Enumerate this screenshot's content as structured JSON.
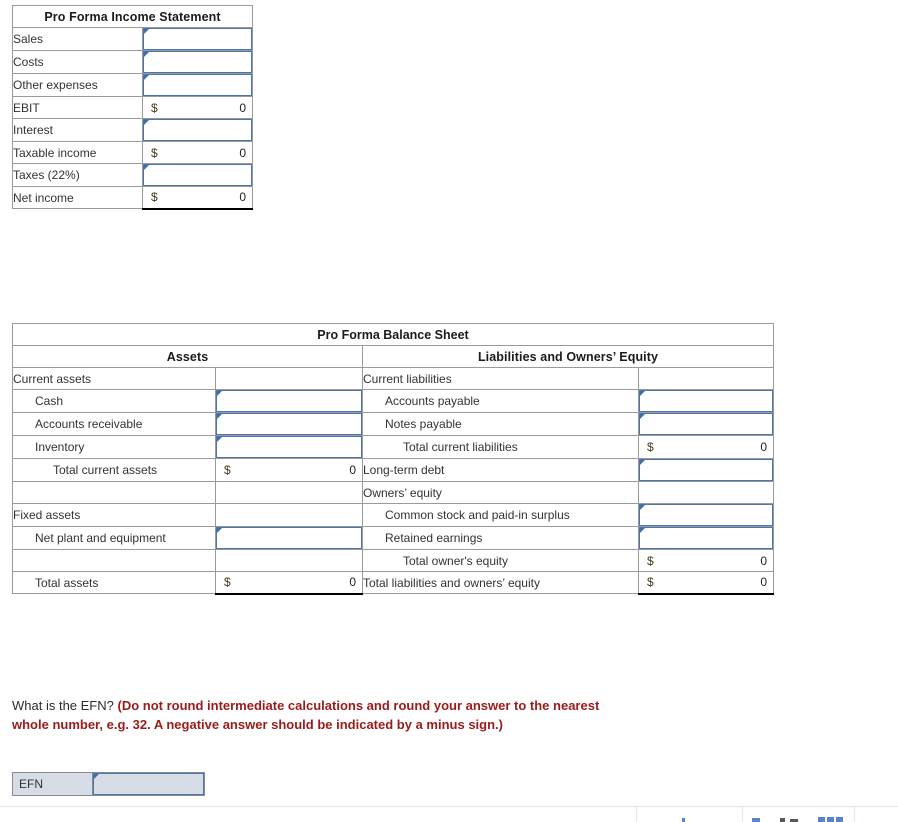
{
  "income_statement": {
    "title": "Pro Forma Income Statement",
    "currency_symbol": "$",
    "rows": [
      {
        "label": "Sales",
        "type": "input",
        "value": ""
      },
      {
        "label": "Costs",
        "type": "input",
        "value": ""
      },
      {
        "label": "Other expenses",
        "type": "input",
        "value": ""
      },
      {
        "label": "EBIT",
        "type": "calc",
        "symbol": "$",
        "value": "0"
      },
      {
        "label": "Interest",
        "type": "input",
        "value": ""
      },
      {
        "label": "Taxable income",
        "type": "calc",
        "symbol": "$",
        "value": "0"
      },
      {
        "label": "Taxes (22%)",
        "type": "input",
        "value": ""
      },
      {
        "label": "Net income",
        "type": "calc",
        "symbol": "$",
        "value": "0"
      }
    ]
  },
  "balance_sheet": {
    "title": "Pro Forma Balance Sheet",
    "assets_header": "Assets",
    "liabilities_header": "Liabilities and Owners’ Equity",
    "rows": [
      {
        "left": {
          "label": "Current assets",
          "indent": 0,
          "type": "none"
        },
        "right": {
          "label": "Current liabilities",
          "indent": 0,
          "type": "none"
        }
      },
      {
        "left": {
          "label": "Cash",
          "indent": 1,
          "type": "input",
          "value": ""
        },
        "right": {
          "label": "Accounts payable",
          "indent": 1,
          "type": "input",
          "value": ""
        }
      },
      {
        "left": {
          "label": "Accounts receivable",
          "indent": 1,
          "type": "input",
          "value": ""
        },
        "right": {
          "label": "Notes payable",
          "indent": 1,
          "type": "input",
          "value": ""
        }
      },
      {
        "left": {
          "label": "Inventory",
          "indent": 1,
          "type": "input",
          "value": ""
        },
        "right": {
          "label": "Total current liabilities",
          "indent": 2,
          "type": "calc",
          "symbol": "$",
          "value": "0"
        }
      },
      {
        "left": {
          "label": "Total current assets",
          "indent": 2,
          "type": "calc",
          "symbol": "$",
          "value": "0"
        },
        "right": {
          "label": "Long-term debt",
          "indent": 0,
          "type": "input",
          "value": ""
        }
      },
      {
        "left": {
          "label": "",
          "indent": 0,
          "type": "blank"
        },
        "right": {
          "label": "Owners’ equity",
          "indent": 0,
          "type": "none"
        }
      },
      {
        "left": {
          "label": "Fixed assets",
          "indent": 0,
          "type": "none"
        },
        "right": {
          "label": "Common stock and paid-in surplus",
          "indent": 1,
          "type": "input",
          "value": ""
        }
      },
      {
        "left": {
          "label": "Net plant and equipment",
          "indent": 1,
          "type": "input",
          "value": ""
        },
        "right": {
          "label": "Retained earnings",
          "indent": 1,
          "type": "input",
          "value": ""
        }
      },
      {
        "left": {
          "label": "",
          "indent": 0,
          "type": "blank"
        },
        "right": {
          "label": "Total owner's equity",
          "indent": 2,
          "type": "calc",
          "symbol": "$",
          "value": "0"
        }
      },
      {
        "left": {
          "label": "Total assets",
          "indent": 1,
          "type": "calc",
          "symbol": "$",
          "value": "0",
          "rule": true
        },
        "right": {
          "label": "Total liabilities and owners’ equity",
          "indent": 0,
          "type": "calc",
          "symbol": "$",
          "value": "0",
          "rule": true
        }
      }
    ]
  },
  "question": {
    "prompt": "What is the EFN? ",
    "instruction": "(Do not round intermediate calculations and round your answer to the nearest whole number, e.g. 32. A negative answer should be indicated by a minus sign.)"
  },
  "answer": {
    "label": "EFN",
    "value": "",
    "placeholder": ""
  },
  "colors": {
    "header_band": "#d3d9e3",
    "input_border": "#4a77b0",
    "calc_border": "#1a1a1a",
    "grid_line": "#9a9a9a",
    "instruction_red": "#9b1b1b",
    "answer_row_bg": "#d7dde7",
    "flag_blue": "#3b6fae"
  }
}
